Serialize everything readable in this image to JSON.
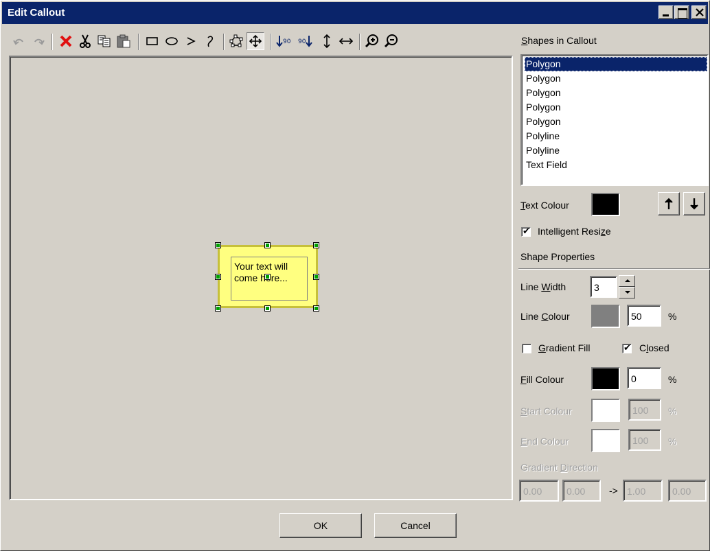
{
  "window": {
    "title": "Edit Callout"
  },
  "toolbar": {
    "tools": [
      "undo-icon",
      "redo-icon",
      "delete-icon",
      "cut-icon",
      "copy-icon",
      "paste-icon",
      "rectangle-tool-icon",
      "ellipse-tool-icon",
      "polyline-tool-icon",
      "curve-tool-icon",
      "edit-points-icon",
      "move-icon",
      "rotate-left-90-icon",
      "rotate-right-90-icon",
      "flip-vertical-icon",
      "flip-horizontal-icon",
      "zoom-in-icon",
      "zoom-out-icon"
    ],
    "active_tool": "move-icon"
  },
  "canvas": {
    "callout_text": "Your text will come here...",
    "callout_fill": "#ffff80"
  },
  "shapes_panel": {
    "label": "Shapes in Callout",
    "items": [
      "Polygon",
      "Polygon",
      "Polygon",
      "Polygon",
      "Polygon",
      "Polyline",
      "Polyline",
      "Text Field"
    ],
    "selected_index": 0,
    "text_colour_label": "Text Colour",
    "text_colour": "#000000",
    "intelligent_resize_label": "Intelligent Resize",
    "intelligent_resize": true
  },
  "shape_properties": {
    "header": "Shape Properties",
    "line_width_label": "Line Width",
    "line_width": "3",
    "line_colour_label": "Line Colour",
    "line_colour": "#808080",
    "line_colour_pct": "50",
    "gradient_fill_label": "Gradient Fill",
    "gradient_fill": false,
    "closed_label": "Closed",
    "closed": true,
    "fill_colour_label": "Fill Colour",
    "fill_colour": "#000000",
    "fill_colour_pct": "0",
    "start_colour_label": "Start Colour",
    "start_colour_pct": "100",
    "end_colour_label": "End Colour",
    "end_colour_pct": "100",
    "gradient_direction_label": "Gradient Direction",
    "gradient_direction": [
      "0.00",
      "0.00",
      "1.00",
      "0.00"
    ],
    "gradient_arrow": "->",
    "percent": "%"
  },
  "buttons": {
    "ok": "OK",
    "cancel": "Cancel"
  }
}
